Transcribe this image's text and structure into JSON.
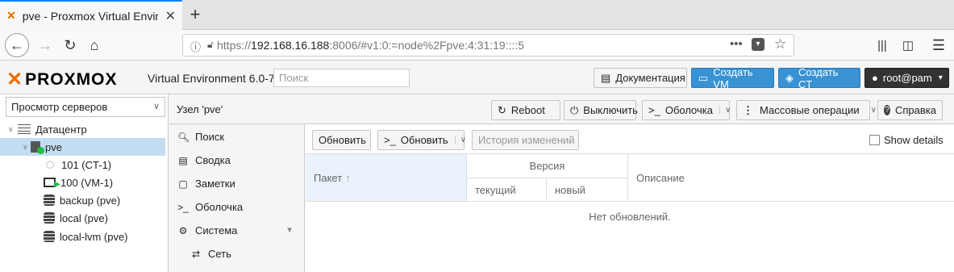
{
  "browser": {
    "tab_title": "pve - Proxmox Virtual Environment",
    "url_prefix": "https://",
    "url_host": "192.168.16.188",
    "url_rest": ":8006/#v1:0:=node%2Fpve:4:31:19::::5"
  },
  "header": {
    "logo": "PROXMOX",
    "version": "Virtual Environment 6.0-7",
    "search_placeholder": "Поиск",
    "docs": "Документация",
    "create_vm": "Создать VM",
    "create_ct": "Создать CT",
    "user": "root@pam"
  },
  "tree": {
    "view": "Просмотр серверов",
    "items": [
      {
        "label": "Датацентр"
      },
      {
        "label": "pve"
      },
      {
        "label": "101 (CT-1)"
      },
      {
        "label": "100 (VM-1)"
      },
      {
        "label": "backup (pve)"
      },
      {
        "label": "local (pve)"
      },
      {
        "label": "local-lvm (pve)"
      }
    ]
  },
  "nodebar": {
    "title": "Узел 'pve'",
    "reboot": "Reboot",
    "shutdown": "Выключить",
    "shell": "Оболочка",
    "bulk": "Массовые операции",
    "help": "Справка"
  },
  "menu": {
    "items": [
      "Поиск",
      "Сводка",
      "Заметки",
      "Оболочка",
      "Система",
      "Сеть"
    ]
  },
  "panel": {
    "refresh": "Обновить",
    "upgrade": "Обновить",
    "changelog": "История изменений",
    "show_details": "Show details",
    "col_package": "Пакет",
    "col_version": "Версия",
    "col_current": "текущий",
    "col_new": "новый",
    "col_description": "Описание",
    "empty": "Нет обновлений."
  }
}
